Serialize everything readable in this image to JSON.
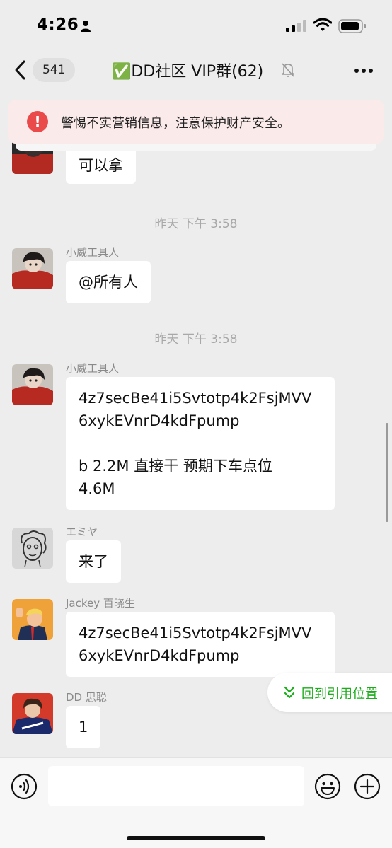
{
  "status_bar": {
    "time": "4:26"
  },
  "nav": {
    "unread_count": "541",
    "title": "✅DD社区 VIP群(62)",
    "muted": true
  },
  "warning": {
    "icon": "!",
    "text": "警惕不实营销信息，注意保护财产安全。"
  },
  "messages": [
    {
      "kind": "partial",
      "text": "可以拿"
    },
    {
      "kind": "timestamp",
      "text": "昨天 下午 3:58"
    },
    {
      "kind": "message",
      "sender": "小威工具人",
      "avatar": "anime-boy-red-avatar",
      "lines": [
        "@所有人"
      ]
    },
    {
      "kind": "timestamp",
      "text": "昨天 下午 3:58"
    },
    {
      "kind": "message",
      "sender": "小威工具人",
      "avatar": "anime-boy-red-avatar",
      "lines": [
        "4z7secBe41i5Svtotp4k2FsjMVV",
        "6xykEVnrD4kdFpump",
        "",
        "b 2.2M 直接干  预期下车点位",
        "4.6M"
      ]
    },
    {
      "kind": "message",
      "sender": "エミヤ",
      "avatar": "sketch-face-avatar",
      "lines": [
        "来了"
      ]
    },
    {
      "kind": "message",
      "sender": "Jackey 百晓生",
      "avatar": "cartoon-politician-avatar",
      "lines": [
        "4z7secBe41i5Svtotp4k2FsjMVV",
        "6xykEVnrD4kdFpump"
      ]
    },
    {
      "kind": "message",
      "sender": "DD 思聪",
      "avatar": "anime-boy-blue-avatar",
      "lines": [
        "1"
      ]
    }
  ],
  "jump_to_quote": {
    "label": "回到引用位置"
  },
  "input": {
    "placeholder": ""
  },
  "colors": {
    "accent_green": "#1aad19",
    "warning_red": "#ea4a4a",
    "warning_bg": "#fbeaea",
    "chat_bg": "#ededed"
  }
}
